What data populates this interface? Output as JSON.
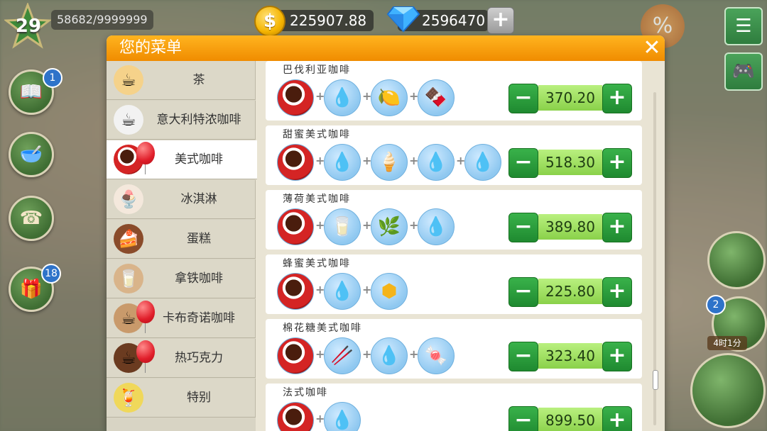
{
  "hud": {
    "level": "29",
    "xp": "58682/9999999",
    "coins": "225907.88",
    "coin_symbol": "$",
    "gems": "2596470",
    "gem_plus": "+"
  },
  "left_buttons": [
    {
      "name": "recipe-book",
      "badge": "1"
    },
    {
      "name": "ingredients",
      "badge": ""
    },
    {
      "name": "phone",
      "badge": ""
    },
    {
      "name": "gift",
      "badge": "18"
    }
  ],
  "right_widgets": {
    "discount": "%",
    "cup_badge": "2",
    "timer": "4时1分"
  },
  "dialog": {
    "title": "您的菜单",
    "close": "✕"
  },
  "categories": [
    {
      "label": "茶",
      "selected": false,
      "balloon": false
    },
    {
      "label": "意大利特浓咖啡",
      "selected": false,
      "balloon": false
    },
    {
      "label": "美式咖啡",
      "selected": true,
      "balloon": true
    },
    {
      "label": "冰淇淋",
      "selected": false,
      "balloon": false
    },
    {
      "label": "蛋糕",
      "selected": false,
      "balloon": false
    },
    {
      "label": "拿铁咖啡",
      "selected": false,
      "balloon": false
    },
    {
      "label": "卡布奇诺咖啡",
      "selected": false,
      "balloon": true
    },
    {
      "label": "热巧克力",
      "selected": false,
      "balloon": true
    },
    {
      "label": "特别",
      "selected": false,
      "balloon": false
    }
  ],
  "items": [
    {
      "name": "巴伐利亚咖啡",
      "price": "370.20",
      "ingredients": [
        "red-cup",
        "coffee-drop",
        "lemon",
        "chocolate"
      ]
    },
    {
      "name": "甜蜜美式咖啡",
      "price": "518.30",
      "ingredients": [
        "red-cup",
        "coffee-drop",
        "whipped-cream",
        "orange-drop",
        "yellow-drop"
      ]
    },
    {
      "name": "薄荷美式咖啡",
      "price": "389.80",
      "ingredients": [
        "red-cup",
        "milk-pitcher",
        "mint",
        "yellow-drop"
      ]
    },
    {
      "name": "蜂蜜美式咖啡",
      "price": "225.80",
      "ingredients": [
        "red-cup",
        "coffee-drop",
        "honeycomb"
      ]
    },
    {
      "name": "棉花糖美式咖啡",
      "price": "323.40",
      "ingredients": [
        "red-cup",
        "cinnamon",
        "orange-drop",
        "marshmallow"
      ]
    },
    {
      "name": "法式咖啡",
      "price": "899.50",
      "ingredients": [
        "red-cup",
        "red-drop"
      ]
    }
  ],
  "controls": {
    "minus": "−",
    "plus": "+"
  }
}
